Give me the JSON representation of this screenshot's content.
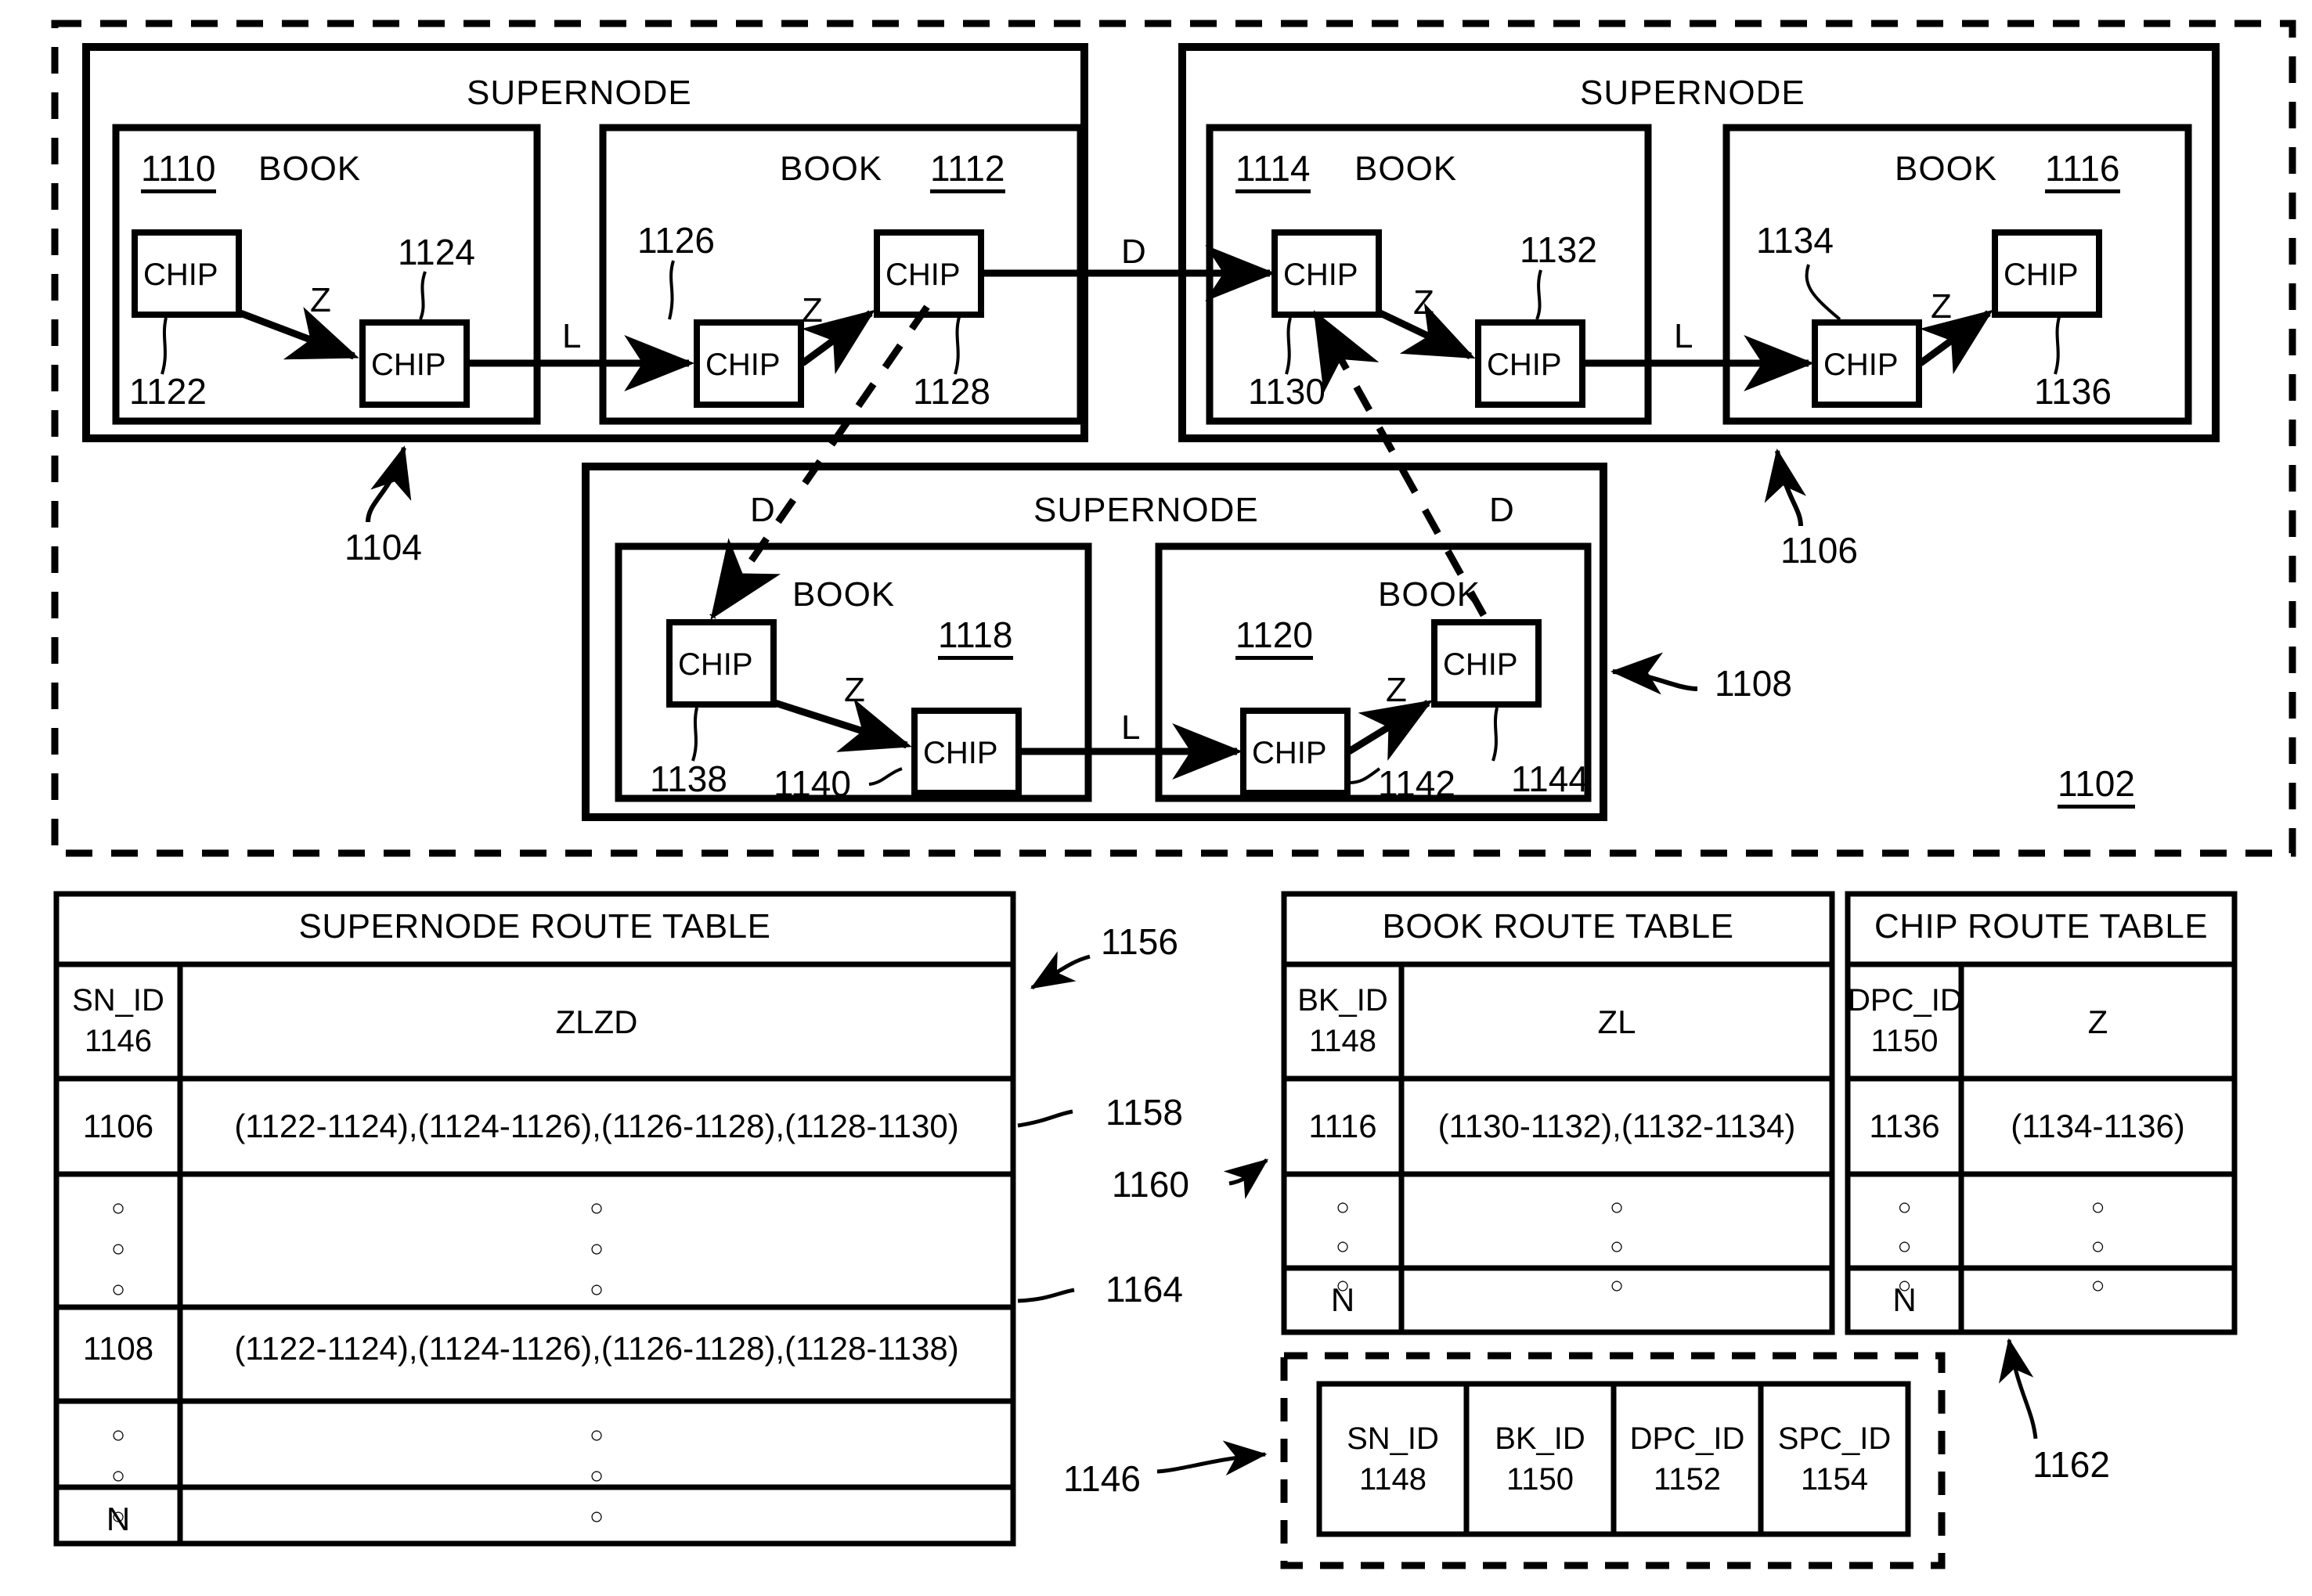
{
  "figure": {
    "system_ref": "1102",
    "supernode_refs": [
      "1104",
      "1106",
      "1108"
    ],
    "supernode_caption": "SUPERNODE",
    "book_caption": "BOOK",
    "chip_caption": "CHIP",
    "link_z": "Z",
    "link_l": "L",
    "link_d": "D"
  },
  "supernodes": [
    {
      "ref": "1104",
      "caption": "SUPERNODE",
      "books": [
        {
          "ref": "1110",
          "caption": "BOOK",
          "ref_side": "left",
          "chips": [
            {
              "ref": "1122",
              "label": "CHIP"
            },
            {
              "ref": "1124",
              "label": "CHIP"
            }
          ]
        },
        {
          "ref": "1112",
          "caption": "BOOK",
          "ref_side": "right",
          "chips": [
            {
              "ref": "1126",
              "label": "CHIP"
            },
            {
              "ref": "1128",
              "label": "CHIP"
            }
          ]
        }
      ]
    },
    {
      "ref": "1106",
      "caption": "SUPERNODE",
      "books": [
        {
          "ref": "1114",
          "caption": "BOOK",
          "ref_side": "left",
          "chips": [
            {
              "ref": "1130",
              "label": "CHIP"
            },
            {
              "ref": "1132",
              "label": "CHIP"
            }
          ]
        },
        {
          "ref": "1116",
          "caption": "BOOK",
          "ref_side": "right",
          "chips": [
            {
              "ref": "1134",
              "label": "CHIP"
            },
            {
              "ref": "1136",
              "label": "CHIP"
            }
          ]
        }
      ]
    },
    {
      "ref": "1108",
      "caption": "SUPERNODE",
      "books": [
        {
          "ref": "1118",
          "caption": "BOOK",
          "ref_side": "right",
          "chips": [
            {
              "ref": "1138",
              "label": "CHIP"
            },
            {
              "ref": "1140",
              "label": "CHIP"
            }
          ]
        },
        {
          "ref": "1120",
          "caption": "BOOK",
          "ref_side": "left",
          "chips": [
            {
              "ref": "1142",
              "label": "CHIP"
            },
            {
              "ref": "1144",
              "label": "CHIP"
            }
          ]
        }
      ]
    }
  ],
  "tables": {
    "supernode_route_table": {
      "ref": "1156",
      "title": "SUPERNODE ROUTE TABLE",
      "columns": [
        {
          "name": "SN_ID",
          "ref": "1146"
        },
        {
          "name": "ZLZD",
          "ref": ""
        }
      ],
      "rows": [
        {
          "ref": "1158",
          "id": "1106",
          "route": "(1122-1124),(1124-1126),(1126-1128),(1128-1130)"
        },
        {
          "ref": "",
          "id": "○\n○\n○",
          "route": "○\n○\n○",
          "ellipsis": true
        },
        {
          "ref": "1164",
          "id": "1108",
          "route": "(1122-1124),(1124-1126),(1126-1128),(1128-1138)"
        },
        {
          "ref": "",
          "id": "○\n○\n○",
          "route": "○\n○\n○",
          "ellipsis": true
        },
        {
          "ref": "",
          "id": "N",
          "route": ""
        }
      ]
    },
    "book_route_table": {
      "ref": "1160",
      "title": "BOOK ROUTE TABLE",
      "columns": [
        {
          "name": "BK_ID",
          "ref": "1148"
        },
        {
          "name": "ZL",
          "ref": ""
        }
      ],
      "rows": [
        {
          "id": "1116",
          "route": "(1130-1132),(1132-1134)"
        },
        {
          "id": "○○○",
          "route": "○○○",
          "ellipsis": true
        },
        {
          "id": "N",
          "route": ""
        }
      ]
    },
    "chip_route_table": {
      "ref": "1162",
      "title": "CHIP ROUTE TABLE",
      "columns": [
        {
          "name": "DPC_ID",
          "ref": "1150"
        },
        {
          "name": "Z",
          "ref": ""
        }
      ],
      "rows": [
        {
          "id": "1136",
          "route": "(1134-1136)"
        },
        {
          "id": "○○○",
          "route": "○○○",
          "ellipsis": true
        },
        {
          "id": "N",
          "route": ""
        }
      ]
    },
    "id_record": {
      "ref": "1146",
      "fields": [
        {
          "name": "SN_ID",
          "ref": "1148"
        },
        {
          "name": "BK_ID",
          "ref": "1150"
        },
        {
          "name": "DPC_ID",
          "ref": "1152"
        },
        {
          "name": "SPC_ID",
          "ref": "1154"
        }
      ]
    }
  }
}
